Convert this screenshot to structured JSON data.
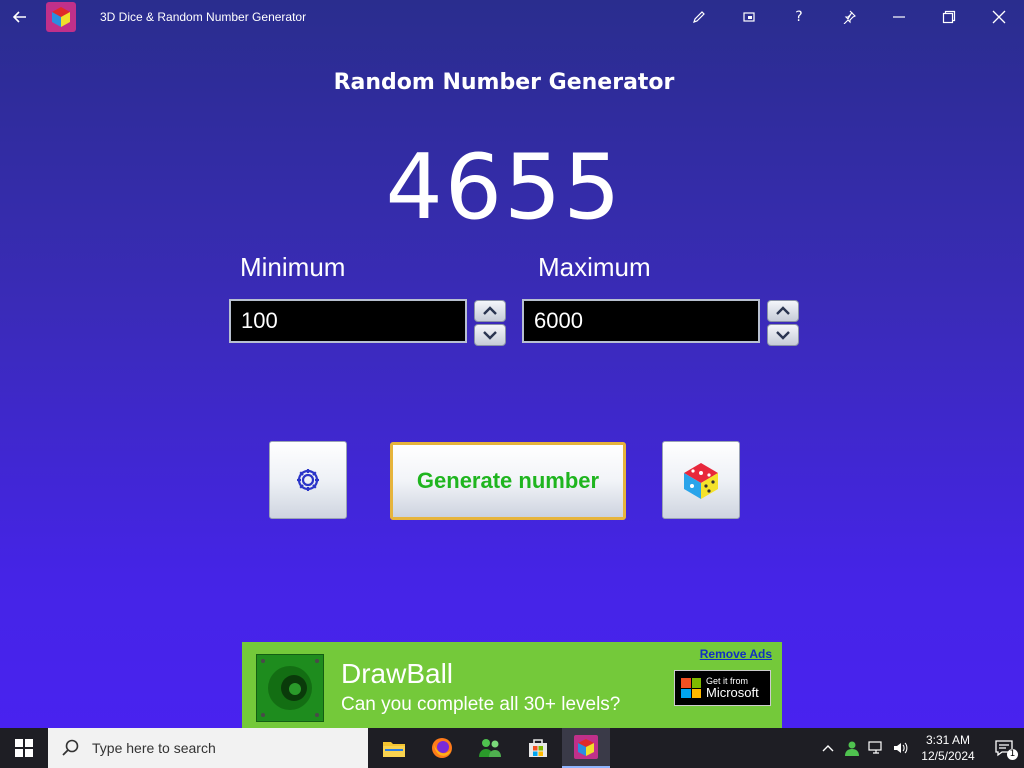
{
  "window": {
    "title": "3D Dice & Random Number Generator",
    "controls": [
      "pen-icon",
      "compact-overlay-icon",
      "help-icon",
      "pin-icon",
      "minimize-icon",
      "maximize-icon",
      "close-icon"
    ],
    "help_label": "?"
  },
  "main": {
    "title": "Random Number Generator",
    "result": "4655",
    "minimum_label": "Minimum",
    "maximum_label": "Maximum",
    "minimum_value": "100",
    "maximum_value": "6000",
    "generate_label": "Generate number"
  },
  "ad": {
    "title": "DrawBall",
    "subtitle": "Can you complete all 30+ levels?",
    "remove_label": "Remove Ads",
    "badge_small": "Get it from",
    "badge_big": "Microsoft"
  },
  "taskbar": {
    "search_placeholder": "Type here to search",
    "time": "3:31 AM",
    "date": "12/5/2024",
    "notification_count": "1"
  },
  "colors": {
    "accent_generate_text": "#1fb51f",
    "generate_border": "#e6b43c",
    "ad_background": "#74c93a",
    "background_top": "#2a2d8e",
    "background_bottom": "#4a22f2"
  }
}
